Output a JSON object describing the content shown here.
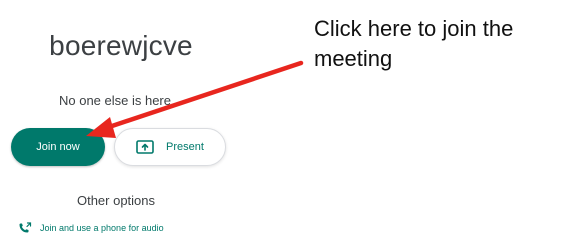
{
  "meeting": {
    "code": "boerewjcve",
    "status": "No one else is here"
  },
  "actions": {
    "join_label": "Join now",
    "present_label": "Present",
    "other_options_label": "Other options",
    "phone_audio_label": "Join and use a phone for audio"
  },
  "annotation": {
    "text": "Click here to join the meeting"
  },
  "colors": {
    "accent": "#00796b",
    "arrow": "#e8261e"
  },
  "icons": {
    "present": "present-icon",
    "phone": "phone-icon"
  }
}
